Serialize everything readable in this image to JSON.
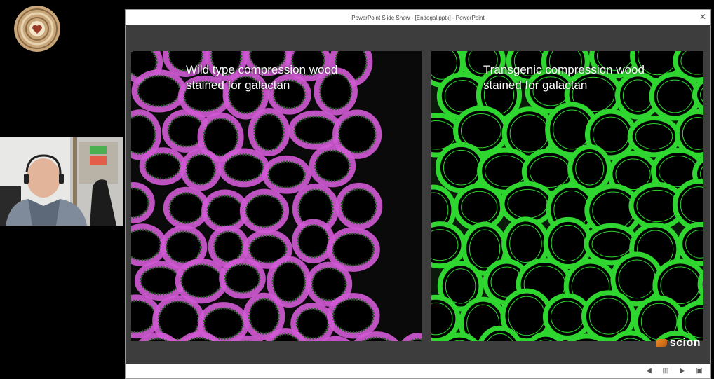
{
  "window": {
    "title": "PowerPoint Slide Show - [Endogal.pptx] - PowerPoint"
  },
  "slide": {
    "left_caption_line1": "Wild type compression wood",
    "left_caption_line2": "stained for galactan",
    "right_caption_line1": "Transgenic compression wood",
    "right_caption_line2": "stained for galactan",
    "logo_text": "scion"
  },
  "colors": {
    "wildtype_stain": "#d15ad4",
    "transgenic_stain": "#2fd62f",
    "accent": "#d24726"
  },
  "icons": {
    "close": "close-icon",
    "prev": "previous-slide-icon",
    "menu": "slide-menu-icon",
    "next": "next-slide-icon",
    "view": "view-icon"
  }
}
